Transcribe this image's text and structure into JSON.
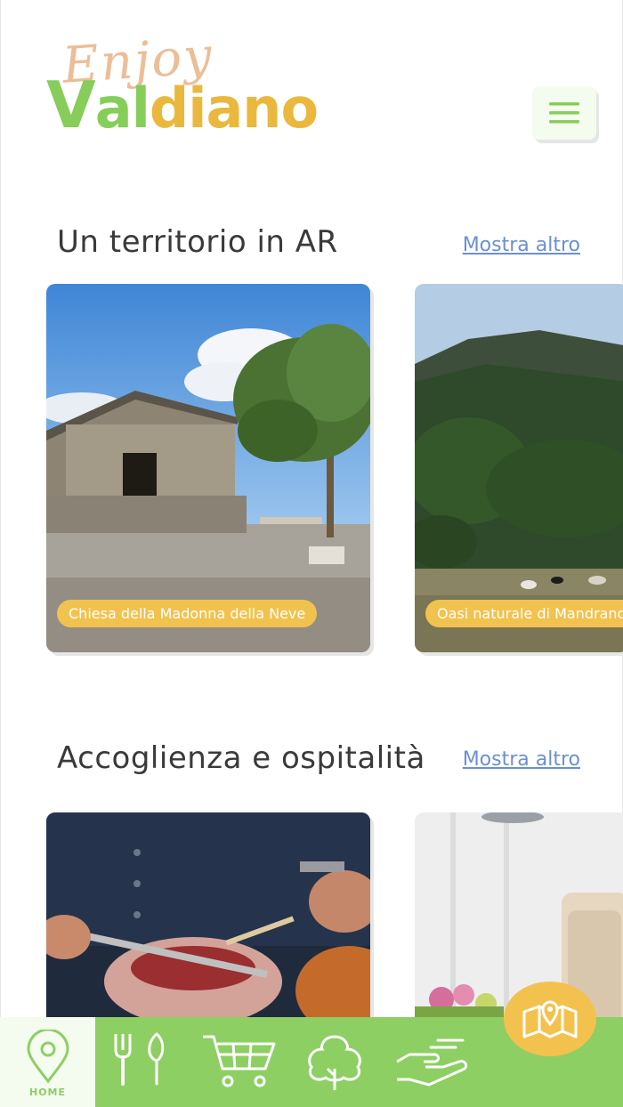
{
  "header": {
    "logo_script": "Enjoy",
    "logo_v": "V",
    "logo_al": "al",
    "logo_rest": "diano",
    "menu_icon": "hamburger-icon"
  },
  "sections": [
    {
      "title": "Un territorio in AR",
      "more": "Mostra altro",
      "cards": [
        {
          "label": "Chiesa della Madonna della Neve"
        },
        {
          "label": "Oasi naturale di Mandrano"
        }
      ]
    },
    {
      "title": "Accoglienza e ospitalità",
      "more": "Mostra altro",
      "cards": [
        {
          "label": ""
        },
        {
          "label": ""
        }
      ]
    }
  ],
  "fab": {
    "icon": "map-pin-icon"
  },
  "nav": {
    "home_label": "HOME",
    "items": [
      "home-pin-icon",
      "fork-knife-icon",
      "cart-icon",
      "tree-icon",
      "hand-icon"
    ]
  },
  "colors": {
    "green": "#8dcf63",
    "yellow": "#f2c24f",
    "link": "#6b8fd6"
  }
}
